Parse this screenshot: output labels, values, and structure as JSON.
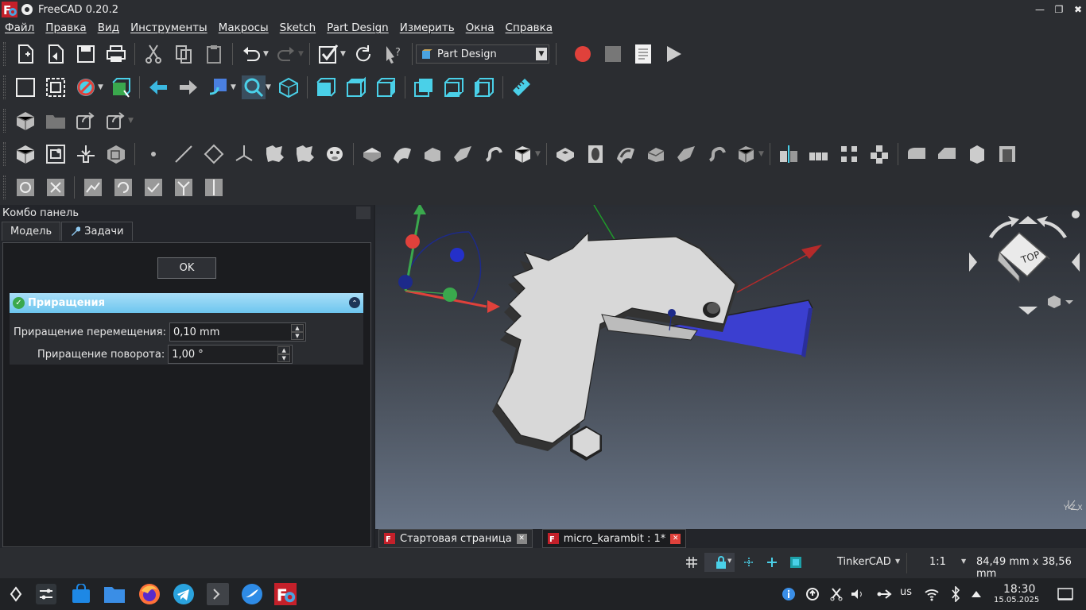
{
  "window": {
    "title": "FreeCAD 0.20.2",
    "minimize": "—",
    "maximize": "❐",
    "close": "✖"
  },
  "menu": [
    "Файл",
    "Правка",
    "Вид",
    "Инструменты",
    "Макросы",
    "Sketch",
    "Part Design",
    "Измерить",
    "Окна",
    "Справка"
  ],
  "toolbar": {
    "workbench": "Part Design"
  },
  "combo": {
    "title": "Комбо панель",
    "tabs": [
      "Модель",
      "Задачи"
    ],
    "ok_label": "OK",
    "panel_title": "Приращения",
    "move_label": "Приращение перемещения:",
    "move_value": "0,10 mm",
    "rotate_label": "Приращение поворота:",
    "rotate_value": "1,00 °"
  },
  "viewport": {
    "navcube_face": "TOP",
    "axis_triad": "Y Z X"
  },
  "doc_tabs": [
    {
      "label": "Стартовая страница"
    },
    {
      "label": "micro_karambit : 1*"
    }
  ],
  "status": {
    "nav_style": "TinkerCAD",
    "zoom": "1:1",
    "dimensions": "84,49 mm x 38,56 mm"
  },
  "taskbar": {
    "keyboard": "us",
    "time": "18:30",
    "date": "15.05.2025"
  },
  "colors": {
    "accent": "#6dc6ef",
    "record": "#e0413b",
    "model": "#d8d8d8",
    "base_plate": "#3b3fd0"
  }
}
